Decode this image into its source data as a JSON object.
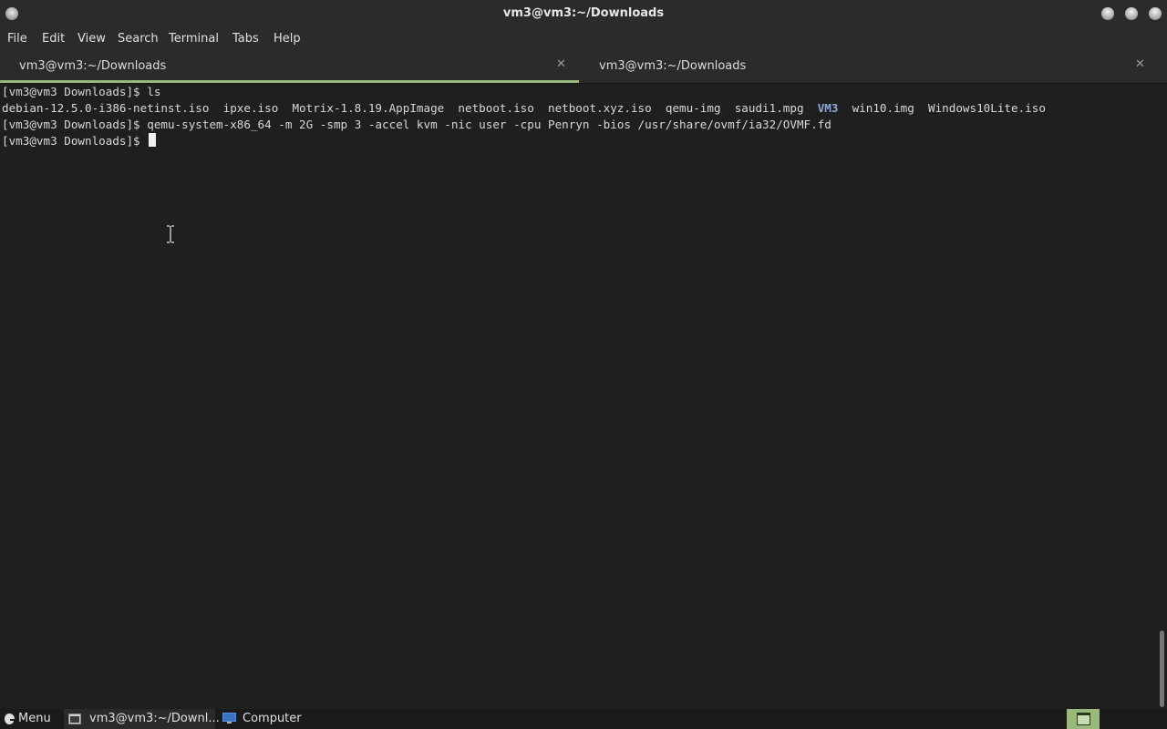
{
  "window": {
    "title": "vm3@vm3:~/Downloads"
  },
  "menubar": {
    "items": [
      "File",
      "Edit",
      "View",
      "Search",
      "Terminal",
      "Tabs",
      "Help"
    ]
  },
  "tabs": [
    {
      "label": "vm3@vm3:~/Downloads",
      "active": true
    },
    {
      "label": "vm3@vm3:~/Downloads",
      "active": false
    }
  ],
  "terminal": {
    "prompt": "[vm3@vm3 Downloads]$ ",
    "cmd1": "ls",
    "ls_files_before": "debian-12.5.0-i386-netinst.iso  ipxe.iso  Motrix-1.8.19.AppImage  netboot.iso  netboot.xyz.iso  qemu-img  saudi1.mpg  ",
    "ls_dir": "VM3",
    "ls_files_after": "  win10.img  Windows10Lite.iso",
    "cmd2": "qemu-system-x86_64 -m 2G -smp 3 -accel kvm -nic user -cpu Penryn -bios /usr/share/ovmf/ia32/OVMF.fd",
    "dir_color": "#8fa8d8"
  },
  "taskbar": {
    "menu_label": "Menu",
    "window_label": "vm3@vm3:~/Downl...",
    "computer_label": "Computer",
    "accent_color": "#9ab87c"
  }
}
